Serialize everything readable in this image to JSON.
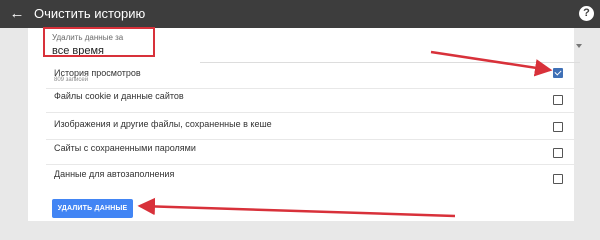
{
  "header": {
    "title": "Очистить историю",
    "back_icon": "arrow-left-icon",
    "help_icon": "help-circle-icon"
  },
  "time_range": {
    "label": "Удалить данные за",
    "value": "все время"
  },
  "items": [
    {
      "label": "История просмотров",
      "sublabel": "809 записей",
      "checked": true
    },
    {
      "label": "Файлы cookie и данные сайтов",
      "checked": false
    },
    {
      "label": "Изображения и другие файлы, сохраненные в кеше",
      "checked": false
    },
    {
      "label": "Сайты с сохраненными паролями",
      "checked": false
    },
    {
      "label": "Данные для автозаполнения",
      "checked": false
    }
  ],
  "actions": {
    "delete_label": "УДАЛИТЬ ДАННЫЕ"
  },
  "colors": {
    "header_bg": "#3d3d3d",
    "accent": "#4285f4",
    "checkbox_checked": "#3f70b6",
    "annotation_red": "#d8313a"
  }
}
